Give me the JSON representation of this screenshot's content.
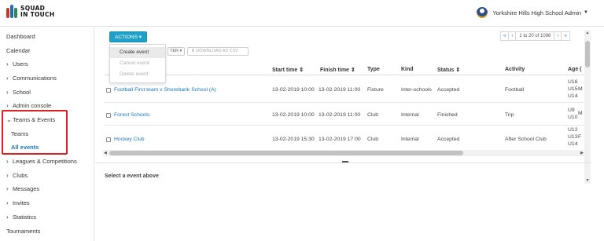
{
  "app": {
    "logo_line1": "SQUAD",
    "logo_line2": "IN TOUCH",
    "user_name": "Yorkshire Hills High School Admin"
  },
  "sidebar": {
    "items": [
      {
        "label": "Dashboard",
        "chevron": ""
      },
      {
        "label": "Calendar",
        "chevron": ""
      },
      {
        "label": "Users",
        "chevron": ">"
      },
      {
        "label": "Communications",
        "chevron": ">"
      },
      {
        "label": "School",
        "chevron": ">"
      },
      {
        "label": "Admin console",
        "chevron": ">"
      },
      {
        "label": "Teams & Events",
        "chevron": "v"
      },
      {
        "label": "Teams",
        "chevron": ""
      },
      {
        "label": "All events",
        "chevron": ""
      },
      {
        "label": "Leagues & Competitions",
        "chevron": ">"
      },
      {
        "label": "Clubs",
        "chevron": ">"
      },
      {
        "label": "Messages",
        "chevron": ">"
      },
      {
        "label": "Invites",
        "chevron": ">"
      },
      {
        "label": "Statistics",
        "chevron": ">"
      },
      {
        "label": "Tournaments",
        "chevron": ""
      }
    ]
  },
  "toolbar": {
    "actions_label": "ACTIONS ▾",
    "menu": [
      "Create event",
      "Cancel event",
      "Delete event"
    ],
    "filter_label": "TER ▾",
    "download_label": "DOWNLOAD AS CSV"
  },
  "pager": {
    "first": "«",
    "prev": "‹",
    "range": "1 to 20 of 1098",
    "next": "›",
    "last": "»"
  },
  "table": {
    "headers": [
      "Start time ⇕",
      "Finish time ⇕",
      "Type",
      "Kind",
      "Status ⇕",
      "Activity",
      "Age ("
    ],
    "rows": [
      {
        "name": "Football First team v Shorebank School (A)",
        "start": "13-02-2019 10:00",
        "finish": "13-02-2019 11:00",
        "type": "Fixture",
        "kind": "Inter-schools",
        "status": "Accepted",
        "activity": "Football",
        "age": [
          "U16",
          "U15",
          "U14"
        ],
        "extra": "M"
      },
      {
        "name": "Forest Schools",
        "start": "13-02-2019 10:00",
        "finish": "13-02-2019 11:00",
        "type": "Club",
        "kind": "Internal",
        "status": "Finished",
        "activity": "Trip",
        "age": [
          "U9",
          "U10"
        ],
        "extra": "M"
      },
      {
        "name": "Hockey Club",
        "start": "13-02-2019 15:30",
        "finish": "13-02-2019 17:00",
        "type": "Club",
        "kind": "Internal",
        "status": "Accepted",
        "activity": "After School Club",
        "age": [
          "U12",
          "U13",
          "U14"
        ],
        "extra": "F"
      }
    ]
  },
  "detail": {
    "message": "Select a event above"
  },
  "colors": {
    "accent": "#1ea0c8",
    "link": "#1976b8",
    "highlight_border": "#e02020"
  },
  "icons": {
    "user_avatar": "school-crest-icon",
    "chevron_right": "chevron-right-icon",
    "chevron_down": "chevron-down-icon"
  }
}
